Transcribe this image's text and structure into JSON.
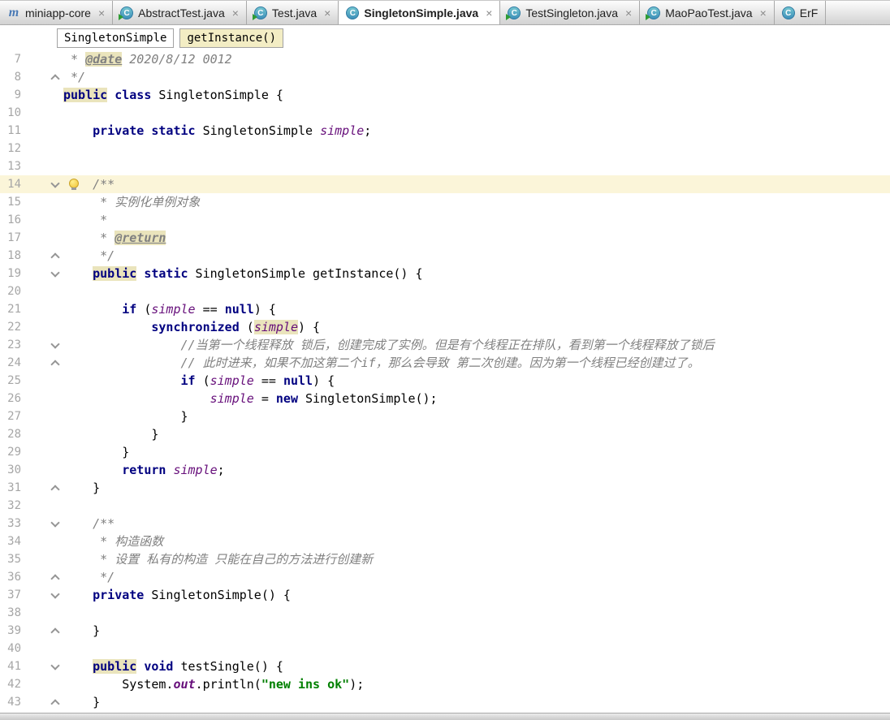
{
  "colors": {
    "keyword": "#000080",
    "comment": "#808080",
    "field": "#660E7A",
    "string": "#008000",
    "usage_highlight": "#EAE4BC",
    "current_line": "#FBF5D9",
    "class_icon": "#3E90BA"
  },
  "tabs": [
    {
      "label": "miniapp-core",
      "icon": "module-icon",
      "test": false,
      "active": false,
      "close": "×"
    },
    {
      "label": "AbstractTest.java",
      "icon": "class-icon",
      "test": true,
      "active": false,
      "close": "×"
    },
    {
      "label": "Test.java",
      "icon": "class-icon",
      "test": true,
      "active": false,
      "close": "×"
    },
    {
      "label": "SingletonSimple.java",
      "icon": "class-icon",
      "test": false,
      "active": true,
      "close": "×"
    },
    {
      "label": "TestSingleton.java",
      "icon": "class-icon",
      "test": true,
      "active": false,
      "close": "×"
    },
    {
      "label": "MaoPaoTest.java",
      "icon": "class-icon",
      "test": true,
      "active": false,
      "close": "×"
    },
    {
      "label": "ErF",
      "icon": "class-icon",
      "test": false,
      "active": false,
      "close": ""
    }
  ],
  "breadcrumb": {
    "class_name": "SingletonSimple",
    "method_name": "getInstance()"
  },
  "editor": {
    "first_visible_line": 7,
    "last_visible_line": 43,
    "lines": [
      {
        "num": 7,
        "fold": null,
        "tokens": [
          [
            " * ",
            "cmt"
          ],
          [
            "@date",
            "doctag"
          ],
          [
            " 2020/8/12 0012",
            "cmt"
          ]
        ]
      },
      {
        "num": 8,
        "fold": "up",
        "tokens": [
          [
            " */",
            "cmt"
          ]
        ]
      },
      {
        "num": 9,
        "fold": null,
        "tokens": [
          [
            "public",
            "kwh"
          ],
          [
            " ",
            "plain"
          ],
          [
            "class",
            "kw"
          ],
          [
            " SingletonSimple {",
            "plain"
          ]
        ]
      },
      {
        "num": 10,
        "fold": null,
        "tokens": []
      },
      {
        "num": 11,
        "fold": null,
        "tokens": [
          [
            "    ",
            "plain"
          ],
          [
            "private",
            "kw"
          ],
          [
            " ",
            "plain"
          ],
          [
            "static",
            "kw"
          ],
          [
            " SingletonSimple ",
            "plain"
          ],
          [
            "simple",
            "field"
          ],
          [
            ";",
            "plain"
          ]
        ]
      },
      {
        "num": 12,
        "fold": null,
        "tokens": []
      },
      {
        "num": 13,
        "fold": null,
        "tokens": []
      },
      {
        "num": 14,
        "fold": "down",
        "current": true,
        "bulb": true,
        "tokens": [
          [
            "    /**",
            "cmt"
          ]
        ]
      },
      {
        "num": 15,
        "fold": null,
        "tokens": [
          [
            "     * 实例化单例对象",
            "cmt"
          ]
        ]
      },
      {
        "num": 16,
        "fold": null,
        "tokens": [
          [
            "     *",
            "cmt"
          ]
        ]
      },
      {
        "num": 17,
        "fold": null,
        "tokens": [
          [
            "     * ",
            "cmt"
          ],
          [
            "@return",
            "doctag"
          ]
        ]
      },
      {
        "num": 18,
        "fold": "up",
        "tokens": [
          [
            "     */",
            "cmt"
          ]
        ]
      },
      {
        "num": 19,
        "fold": "down",
        "tokens": [
          [
            "    ",
            "plain"
          ],
          [
            "public",
            "kwh"
          ],
          [
            " ",
            "plain"
          ],
          [
            "static",
            "kw"
          ],
          [
            " SingletonSimple getInstance() {",
            "plain"
          ]
        ]
      },
      {
        "num": 20,
        "fold": null,
        "tokens": []
      },
      {
        "num": 21,
        "fold": null,
        "tokens": [
          [
            "        ",
            "plain"
          ],
          [
            "if",
            "kw"
          ],
          [
            " (",
            "plain"
          ],
          [
            "simple",
            "field"
          ],
          [
            " == ",
            "plain"
          ],
          [
            "null",
            "kw"
          ],
          [
            ") {",
            "plain"
          ]
        ]
      },
      {
        "num": 22,
        "fold": null,
        "tokens": [
          [
            "            ",
            "plain"
          ],
          [
            "synchronized",
            "kw"
          ],
          [
            " (",
            "plain"
          ],
          [
            "simple",
            "fieldh"
          ],
          [
            ") {",
            "plain"
          ]
        ]
      },
      {
        "num": 23,
        "fold": "down",
        "tokens": [
          [
            "                //当第一个线程释放 锁后，创建完成了实例。但是有个线程正在排队，看到第一个线程释放了锁后",
            "cmt"
          ]
        ]
      },
      {
        "num": 24,
        "fold": "up",
        "tokens": [
          [
            "                // 此时进来，如果不加这第二个if，那么会导致 第二次创建。因为第一个线程已经创建过了。",
            "cmt"
          ]
        ]
      },
      {
        "num": 25,
        "fold": null,
        "tokens": [
          [
            "                ",
            "plain"
          ],
          [
            "if",
            "kw"
          ],
          [
            " (",
            "plain"
          ],
          [
            "simple",
            "field"
          ],
          [
            " == ",
            "plain"
          ],
          [
            "null",
            "kw"
          ],
          [
            ") {",
            "plain"
          ]
        ]
      },
      {
        "num": 26,
        "fold": null,
        "tokens": [
          [
            "                    ",
            "plain"
          ],
          [
            "simple",
            "field"
          ],
          [
            " = ",
            "plain"
          ],
          [
            "new",
            "kw"
          ],
          [
            " SingletonSimple();",
            "plain"
          ]
        ]
      },
      {
        "num": 27,
        "fold": null,
        "tokens": [
          [
            "                }",
            "plain"
          ]
        ]
      },
      {
        "num": 28,
        "fold": null,
        "tokens": [
          [
            "            }",
            "plain"
          ]
        ]
      },
      {
        "num": 29,
        "fold": null,
        "tokens": [
          [
            "        }",
            "plain"
          ]
        ]
      },
      {
        "num": 30,
        "fold": null,
        "tokens": [
          [
            "        ",
            "plain"
          ],
          [
            "return",
            "kw"
          ],
          [
            " ",
            "plain"
          ],
          [
            "simple",
            "field"
          ],
          [
            ";",
            "plain"
          ]
        ]
      },
      {
        "num": 31,
        "fold": "up",
        "tokens": [
          [
            "    }",
            "plain"
          ]
        ]
      },
      {
        "num": 32,
        "fold": null,
        "tokens": []
      },
      {
        "num": 33,
        "fold": "down",
        "tokens": [
          [
            "    /**",
            "cmt"
          ]
        ]
      },
      {
        "num": 34,
        "fold": null,
        "tokens": [
          [
            "     * 构造函数",
            "cmt"
          ]
        ]
      },
      {
        "num": 35,
        "fold": null,
        "tokens": [
          [
            "     * 设置 私有的构造 只能在自己的方法进行创建新",
            "cmt"
          ]
        ]
      },
      {
        "num": 36,
        "fold": "up",
        "tokens": [
          [
            "     */",
            "cmt"
          ]
        ]
      },
      {
        "num": 37,
        "fold": "down",
        "tokens": [
          [
            "    ",
            "plain"
          ],
          [
            "private",
            "kw"
          ],
          [
            " SingletonSimple() {",
            "plain"
          ]
        ]
      },
      {
        "num": 38,
        "fold": null,
        "tokens": []
      },
      {
        "num": 39,
        "fold": "up",
        "tokens": [
          [
            "    }",
            "plain"
          ]
        ]
      },
      {
        "num": 40,
        "fold": null,
        "tokens": []
      },
      {
        "num": 41,
        "fold": "down",
        "tokens": [
          [
            "    ",
            "plain"
          ],
          [
            "public",
            "kwh"
          ],
          [
            " ",
            "plain"
          ],
          [
            "void",
            "kw"
          ],
          [
            " testSingle() {",
            "plain"
          ]
        ]
      },
      {
        "num": 42,
        "fold": null,
        "tokens": [
          [
            "        System.",
            "plain"
          ],
          [
            "out",
            "staticfield"
          ],
          [
            ".println(",
            "plain"
          ],
          [
            "\"new ins ok\"",
            "str"
          ],
          [
            ");",
            "plain"
          ]
        ]
      },
      {
        "num": 43,
        "fold": "up",
        "tokens": [
          [
            "    }",
            "plain"
          ]
        ]
      }
    ]
  }
}
